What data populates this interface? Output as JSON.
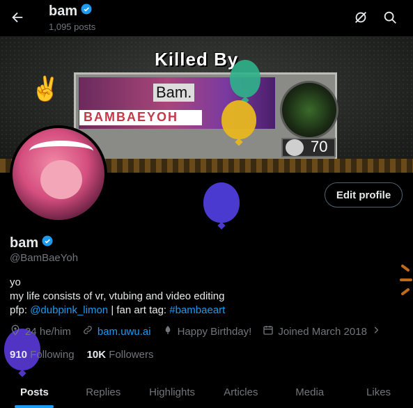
{
  "header": {
    "name": "bam",
    "post_count": "1,095 posts"
  },
  "banner": {
    "killed_text": "Killed By",
    "card_name": "Bam.",
    "card_tag": "BAMBAEYOH",
    "score": "70"
  },
  "profile": {
    "display_name": "bam",
    "handle": "@BamBaeYoh",
    "edit_label": "Edit profile",
    "bio_line1": "yo",
    "bio_line2": "my life consists of vr, vtubing and video editing",
    "bio_pfp_prefix": "pfp: ",
    "bio_pfp_link": "@dubpink_limon",
    "bio_fanart_prefix": " | fan art tag: ",
    "bio_fanart_link": "#bambaeart",
    "pronouns": "24 he/him",
    "website": "bam.uwu.ai",
    "birthday": "Happy Birthday!",
    "joined": "Joined March 2018",
    "following_count": "910",
    "following_label": "Following",
    "followers_count": "10K",
    "followers_label": "Followers"
  },
  "tabs": [
    {
      "label": "Posts"
    },
    {
      "label": "Replies"
    },
    {
      "label": "Highlights"
    },
    {
      "label": "Articles"
    },
    {
      "label": "Media"
    },
    {
      "label": "Likes"
    }
  ],
  "colors": {
    "accent": "#1d9bf0",
    "muted": "#71767b",
    "background": "#000000"
  },
  "icons": [
    "back-arrow-icon",
    "verified-badge-icon",
    "no-notifications-icon",
    "search-icon",
    "balloon-icon",
    "location-icon",
    "link-icon",
    "birthday-icon",
    "calendar-icon",
    "chevron-right-icon"
  ]
}
